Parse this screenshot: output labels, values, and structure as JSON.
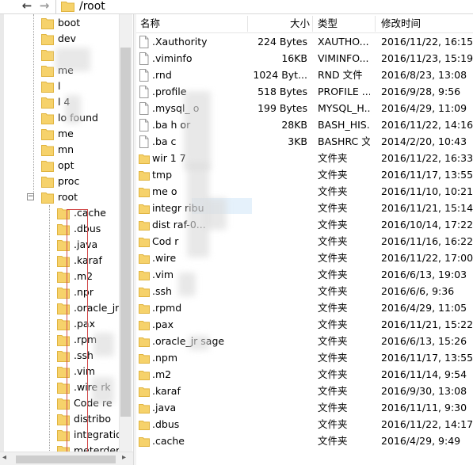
{
  "toolbar": {
    "back_icon": "arrow-left-icon",
    "forward_icon": "arrow-right-icon",
    "path": "/root"
  },
  "colors": {
    "folder": "#f6d26b",
    "folder_dark": "#e0b43f",
    "selection": "#e5f1fb",
    "annotation": "#d14a4a"
  },
  "tree": {
    "items": [
      {
        "label": "boot"
      },
      {
        "label": "dev"
      },
      {
        "label": ""
      },
      {
        "label": "me"
      },
      {
        "label": "l"
      },
      {
        "label": "l 4"
      },
      {
        "label": "lo found"
      },
      {
        "label": "me"
      },
      {
        "label": "mn"
      },
      {
        "label": "opt"
      },
      {
        "label": "proc"
      },
      {
        "label": "root",
        "expanded": true
      },
      {
        "label": ".cache"
      },
      {
        "label": ".dbus"
      },
      {
        "label": ".java"
      },
      {
        "label": ".karaf"
      },
      {
        "label": ".m2"
      },
      {
        "label": ".npr"
      },
      {
        "label": ".oracle_jre"
      },
      {
        "label": ".pax"
      },
      {
        "label": ".rpm"
      },
      {
        "label": ".ssh"
      },
      {
        "label": ".vim"
      },
      {
        "label": ".wire rk"
      },
      {
        "label": "Code re"
      },
      {
        "label": "distribo"
      },
      {
        "label": "integration"
      },
      {
        "label": "meterdem"
      }
    ]
  },
  "list": {
    "columns": {
      "name": "名称",
      "size": "大小",
      "type": "类型",
      "time": "修改时间"
    },
    "rows": [
      {
        "name": ".Xauthority",
        "size": "224 Bytes",
        "type": "XAUTHO...",
        "time": "2016/11/22, 16:15",
        "kind": "file"
      },
      {
        "name": ".viminfo",
        "size": "16KB",
        "type": "VIMINFO...",
        "time": "2016/11/23, 15:19",
        "kind": "file"
      },
      {
        "name": ".rnd",
        "size": "1024 Byt...",
        "type": "RND 文件",
        "time": "2016/8/23, 13:08",
        "kind": "file"
      },
      {
        "name": ".profile",
        "size": "518 Bytes",
        "type": "PROFILE ...",
        "time": "2016/9/28, 9:56",
        "kind": "file"
      },
      {
        "name": ".mysql_ o",
        "size": "199 Bytes",
        "type": "MYSQL_H...",
        "time": "2016/4/29, 11:09",
        "kind": "file"
      },
      {
        "name": ".ba h or",
        "size": "28KB",
        "type": "BASH_HIS...",
        "time": "2016/11/22, 14:16",
        "kind": "file"
      },
      {
        "name": ".ba c",
        "size": "3KB",
        "type": "BASHRC 文件",
        "time": "2014/2/20, 10:43",
        "kind": "file"
      },
      {
        "name": "wir 1 7",
        "size": "",
        "type": "文件夹",
        "time": "2016/11/22, 16:33",
        "kind": "folder"
      },
      {
        "name": "tmp",
        "size": "",
        "type": "文件夹",
        "time": "2016/11/17, 13:55",
        "kind": "folder"
      },
      {
        "name": "me o",
        "size": "",
        "type": "文件夹",
        "time": "2016/11/10, 10:21",
        "kind": "folder"
      },
      {
        "name": "integr ribu",
        "size": "",
        "type": "文件夹",
        "time": "2016/11/21, 15:14",
        "kind": "folder"
      },
      {
        "name": "dist raf-0...",
        "size": "",
        "type": "文件夹",
        "time": "2016/10/14, 17:22",
        "kind": "folder"
      },
      {
        "name": "Cod r",
        "size": "",
        "type": "文件夹",
        "time": "2016/11/16, 16:22",
        "kind": "folder"
      },
      {
        "name": ".wire",
        "size": "",
        "type": "文件夹",
        "time": "2016/11/22, 17:00",
        "kind": "folder"
      },
      {
        "name": ".vim",
        "size": "",
        "type": "文件夹",
        "time": "2016/6/13, 19:03",
        "kind": "folder"
      },
      {
        "name": ".ssh",
        "size": "",
        "type": "文件夹",
        "time": "2016/6/6, 9:36",
        "kind": "folder"
      },
      {
        "name": ".rpmd",
        "size": "",
        "type": "文件夹",
        "time": "2016/4/29, 11:05",
        "kind": "folder"
      },
      {
        "name": ".pax",
        "size": "",
        "type": "文件夹",
        "time": "2016/11/21, 15:22",
        "kind": "folder"
      },
      {
        "name": ".oracle_jr sage",
        "size": "",
        "type": "文件夹",
        "time": "2016/6/13, 15:26",
        "kind": "folder"
      },
      {
        "name": ".npm",
        "size": "",
        "type": "文件夹",
        "time": "2016/11/17, 13:55",
        "kind": "folder"
      },
      {
        "name": ".m2",
        "size": "",
        "type": "文件夹",
        "time": "2016/11/14, 9:54",
        "kind": "folder"
      },
      {
        "name": ".karaf",
        "size": "",
        "type": "文件夹",
        "time": "2016/9/30, 13:08",
        "kind": "folder"
      },
      {
        "name": ".java",
        "size": "",
        "type": "文件夹",
        "time": "2016/11/11, 9:30",
        "kind": "folder"
      },
      {
        "name": ".dbus",
        "size": "",
        "type": "文件夹",
        "time": "2016/11/22, 14:17",
        "kind": "folder"
      },
      {
        "name": ".cache",
        "size": "",
        "type": "文件夹",
        "time": "2016/4/29, 9:49",
        "kind": "folder"
      }
    ]
  }
}
